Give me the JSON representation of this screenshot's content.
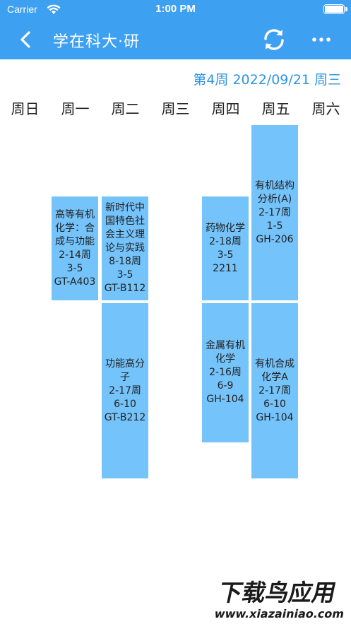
{
  "status_bar": {
    "carrier": "Carrier",
    "time": "1:00 PM"
  },
  "nav": {
    "title": "学在科大·研"
  },
  "header": {
    "date_line": "第4周 2022/09/21 周三"
  },
  "weekdays": [
    "周日",
    "周一",
    "周二",
    "周三",
    "周四",
    "周五",
    "周六"
  ],
  "courses": [
    {
      "name": "高等有机化学：合成与功能",
      "weeks": "2-14周",
      "periods": "3-5",
      "room": "GT-A403"
    },
    {
      "name": "新时代中国特色社会主义理论与实践",
      "weeks": "8-18周",
      "periods": "3-5",
      "room": "GT-B112"
    },
    {
      "name": "功能高分子",
      "weeks": "2-17周",
      "periods": "6-10",
      "room": "GT-B212"
    },
    {
      "name": "药物化学",
      "weeks": "2-18周",
      "periods": "3-5",
      "room": "2211"
    },
    {
      "name": "金属有机化学",
      "weeks": "2-16周",
      "periods": "6-9",
      "room": "GH-104"
    },
    {
      "name": "有机结构分析(A)",
      "weeks": "2-17周",
      "periods": "1-5",
      "room": "GH-206"
    },
    {
      "name": "有机合成化学A",
      "weeks": "2-17周",
      "periods": "6-10",
      "room": "GH-104"
    }
  ],
  "watermark": {
    "text": "下载鸟应用",
    "url": "www.xiazainiao.com"
  },
  "colors": {
    "nav_blue": "#3ea0f0",
    "course_blue": "#74c3fb",
    "date_blue": "#2f95e4"
  }
}
